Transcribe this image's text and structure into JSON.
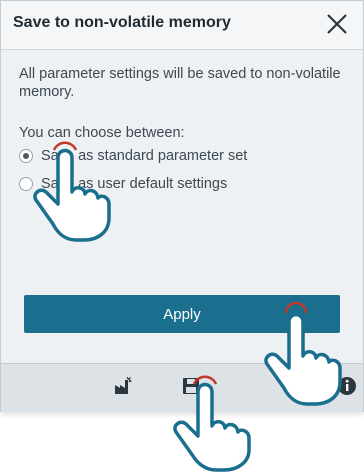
{
  "dialog": {
    "title": "Save to non-volatile memory",
    "description": "All parameter settings will be saved to non-volatile memory.",
    "choose_label": "You can choose between:",
    "options": [
      {
        "label": "Save as standard parameter set",
        "selected": true
      },
      {
        "label": "Save as user default settings",
        "selected": false
      }
    ],
    "apply_label": "Apply"
  },
  "footer": {
    "icons": [
      "factory-icon",
      "save-icon",
      "info-icon"
    ]
  },
  "colors": {
    "accent": "#1a6e8e",
    "dialog_bg": "#eef1f3",
    "footer_bg": "#dde2e6"
  }
}
